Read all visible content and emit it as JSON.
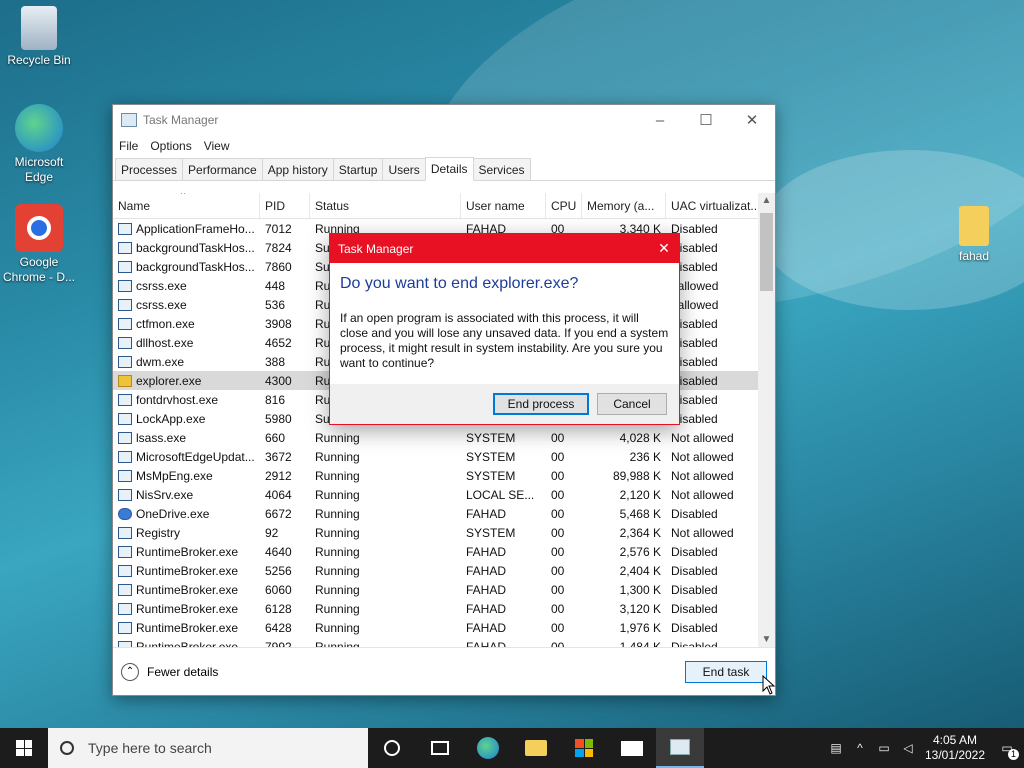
{
  "desktop": {
    "icons": [
      {
        "label": "Recycle Bin"
      },
      {
        "label": "Microsoft Edge"
      },
      {
        "label": "Google Chrome - D..."
      },
      {
        "label": "fahad"
      }
    ]
  },
  "taskmanager": {
    "title": "Task Manager",
    "menu": [
      "File",
      "Options",
      "View"
    ],
    "tabs": [
      "Processes",
      "Performance",
      "App history",
      "Startup",
      "Users",
      "Details",
      "Services"
    ],
    "active_tab": "Details",
    "columns": [
      "Name",
      "PID",
      "Status",
      "User name",
      "CPU",
      "Memory (a...",
      "UAC virtualizat..."
    ],
    "rows": [
      {
        "name": "ApplicationFrameHo...",
        "pid": "7012",
        "status": "Running",
        "user": "FAHAD",
        "cpu": "00",
        "mem": "3,340 K",
        "uac": "Disabled"
      },
      {
        "name": "backgroundTaskHos...",
        "pid": "7824",
        "status": "Su",
        "user": "",
        "cpu": "",
        "mem": "",
        "uac": "Disabled"
      },
      {
        "name": "backgroundTaskHos...",
        "pid": "7860",
        "status": "Su",
        "user": "",
        "cpu": "",
        "mem": "",
        "uac": "Disabled"
      },
      {
        "name": "csrss.exe",
        "pid": "448",
        "status": "Ru",
        "user": "",
        "cpu": "",
        "mem": "",
        "uac": "t allowed"
      },
      {
        "name": "csrss.exe",
        "pid": "536",
        "status": "Ru",
        "user": "",
        "cpu": "",
        "mem": "",
        "uac": "t allowed"
      },
      {
        "name": "ctfmon.exe",
        "pid": "3908",
        "status": "Ru",
        "user": "",
        "cpu": "",
        "mem": "",
        "uac": "Disabled"
      },
      {
        "name": "dllhost.exe",
        "pid": "4652",
        "status": "Ru",
        "user": "",
        "cpu": "",
        "mem": "",
        "uac": "Disabled"
      },
      {
        "name": "dwm.exe",
        "pid": "388",
        "status": "Ru",
        "user": "",
        "cpu": "",
        "mem": "",
        "uac": "Disabled"
      },
      {
        "name": "explorer.exe",
        "pid": "4300",
        "status": "Ru",
        "user": "",
        "cpu": "",
        "mem": "",
        "uac": "Disabled",
        "selected": true,
        "icon": "exp"
      },
      {
        "name": "fontdrvhost.exe",
        "pid": "816",
        "status": "Ru",
        "user": "",
        "cpu": "",
        "mem": "",
        "uac": "Disabled"
      },
      {
        "name": "LockApp.exe",
        "pid": "5980",
        "status": "Su",
        "user": "",
        "cpu": "",
        "mem": "",
        "uac": "Disabled"
      },
      {
        "name": "lsass.exe",
        "pid": "660",
        "status": "Running",
        "user": "SYSTEM",
        "cpu": "00",
        "mem": "4,028 K",
        "uac": "Not allowed"
      },
      {
        "name": "MicrosoftEdgeUpdat...",
        "pid": "3672",
        "status": "Running",
        "user": "SYSTEM",
        "cpu": "00",
        "mem": "236 K",
        "uac": "Not allowed"
      },
      {
        "name": "MsMpEng.exe",
        "pid": "2912",
        "status": "Running",
        "user": "SYSTEM",
        "cpu": "00",
        "mem": "89,988 K",
        "uac": "Not allowed"
      },
      {
        "name": "NisSrv.exe",
        "pid": "4064",
        "status": "Running",
        "user": "LOCAL SE...",
        "cpu": "00",
        "mem": "2,120 K",
        "uac": "Not allowed"
      },
      {
        "name": "OneDrive.exe",
        "pid": "6672",
        "status": "Running",
        "user": "FAHAD",
        "cpu": "00",
        "mem": "5,468 K",
        "uac": "Disabled",
        "icon": "od"
      },
      {
        "name": "Registry",
        "pid": "92",
        "status": "Running",
        "user": "SYSTEM",
        "cpu": "00",
        "mem": "2,364 K",
        "uac": "Not allowed"
      },
      {
        "name": "RuntimeBroker.exe",
        "pid": "4640",
        "status": "Running",
        "user": "FAHAD",
        "cpu": "00",
        "mem": "2,576 K",
        "uac": "Disabled"
      },
      {
        "name": "RuntimeBroker.exe",
        "pid": "5256",
        "status": "Running",
        "user": "FAHAD",
        "cpu": "00",
        "mem": "2,404 K",
        "uac": "Disabled"
      },
      {
        "name": "RuntimeBroker.exe",
        "pid": "6060",
        "status": "Running",
        "user": "FAHAD",
        "cpu": "00",
        "mem": "1,300 K",
        "uac": "Disabled"
      },
      {
        "name": "RuntimeBroker.exe",
        "pid": "6128",
        "status": "Running",
        "user": "FAHAD",
        "cpu": "00",
        "mem": "3,120 K",
        "uac": "Disabled"
      },
      {
        "name": "RuntimeBroker.exe",
        "pid": "6428",
        "status": "Running",
        "user": "FAHAD",
        "cpu": "00",
        "mem": "1,976 K",
        "uac": "Disabled"
      },
      {
        "name": "RuntimeBroker.exe",
        "pid": "7992",
        "status": "Running",
        "user": "FAHAD",
        "cpu": "00",
        "mem": "1,484 K",
        "uac": "Disabled"
      }
    ],
    "fewer_details": "Fewer details",
    "end_task": "End task"
  },
  "dialog": {
    "title": "Task Manager",
    "heading": "Do you want to end explorer.exe?",
    "body": "If an open program is associated with this process, it will close and you will lose any unsaved data. If you end a system process, it might result in system instability. Are you sure you want to continue?",
    "primary": "End process",
    "cancel": "Cancel"
  },
  "taskbar": {
    "search_placeholder": "Type here to search",
    "time": "4:05 AM",
    "date": "13/01/2022",
    "notification_count": "1"
  },
  "colors": {
    "accent": "#0078d7",
    "dialog_title": "#e81123",
    "dialog_heading": "#1c3d9a"
  }
}
